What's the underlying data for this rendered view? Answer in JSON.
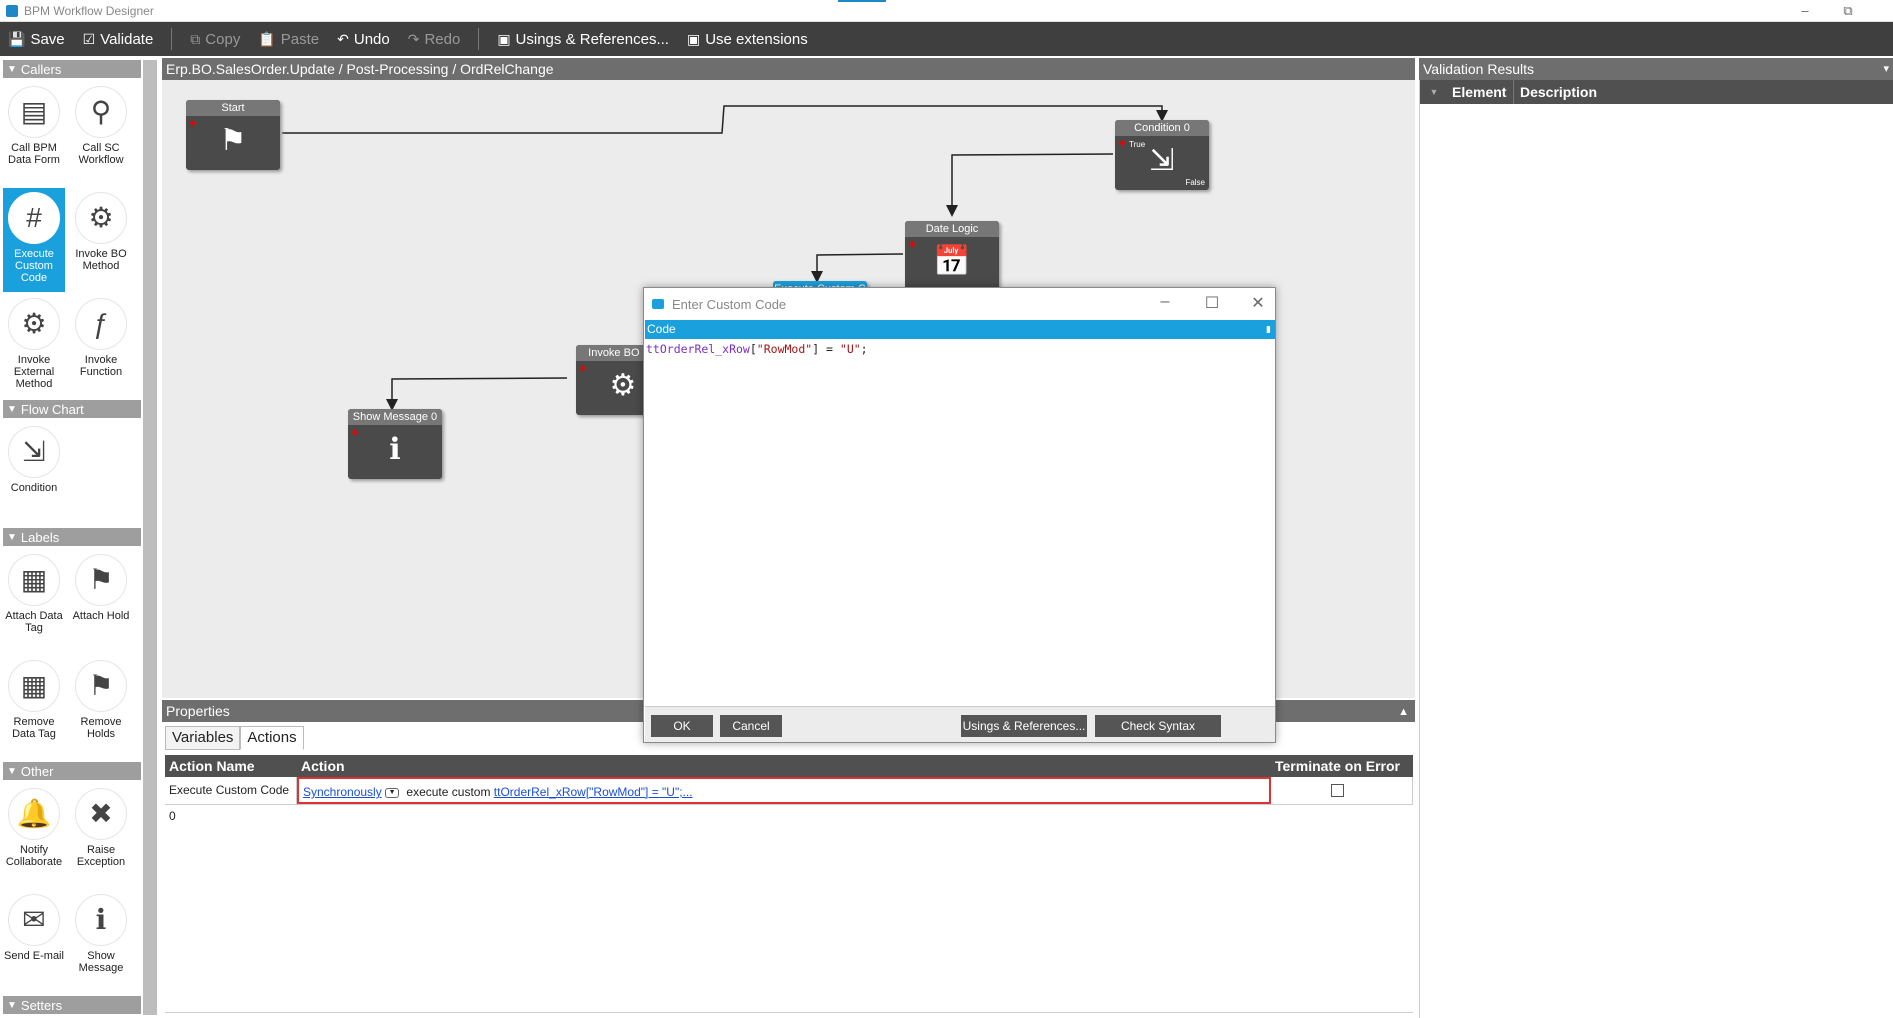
{
  "window": {
    "title": "BPM Workflow Designer"
  },
  "toolbar": {
    "save": "Save",
    "validate": "Validate",
    "copy": "Copy",
    "paste": "Paste",
    "undo": "Undo",
    "redo": "Redo",
    "usings": "Usings & References...",
    "extensions": "Use extensions"
  },
  "palette": {
    "callers": "Callers",
    "call_bpm": "Call BPM Data Form",
    "call_sc": "Call SC Workflow",
    "exec_custom": "Execute Custom Code",
    "invoke_bo": "Invoke BO Method",
    "invoke_ext": "Invoke External Method",
    "invoke_fn": "Invoke Function",
    "flowchart": "Flow Chart",
    "condition": "Condition",
    "labels": "Labels",
    "attach_tag": "Attach Data Tag",
    "attach_hold": "Attach Hold",
    "remove_tag": "Remove Data Tag",
    "remove_holds": "Remove Holds",
    "other": "Other",
    "notify": "Notify Collaborate",
    "raise": "Raise Exception",
    "send_email": "Send E-mail",
    "show_msg": "Show Message",
    "setters": "Setters"
  },
  "canvas": {
    "breadcrumb": "Erp.BO.SalesOrder.Update / Post-Processing / OrdRelChange",
    "nodes": {
      "start": "Start",
      "condition": "Condition 0",
      "cond_true": "True",
      "cond_false": "False",
      "date_logic": "Date Logic",
      "invoke_bo": "Invoke BO Me",
      "show_msg": "Show Message 0",
      "exec_custom": "Execute Custom C"
    }
  },
  "properties": {
    "title": "Properties",
    "tabs": [
      "Variables",
      "Actions"
    ],
    "columns": [
      "Action Name",
      "Action",
      "Terminate on Error"
    ],
    "row": {
      "name": "Execute Custom Code 0",
      "mode": "Synchronously",
      "verb": "execute custom",
      "code_link": "ttOrderRel_xRow[\"RowMod\"] = \"U\";..."
    }
  },
  "validation": {
    "title": "Validation Results",
    "columns": [
      "Element",
      "Description"
    ]
  },
  "dialog": {
    "title": "Enter Custom Code",
    "code_header": "Code",
    "code": {
      "ident": "ttOrderRel_xRow",
      "b1": "[",
      "key": "\"RowMod\"",
      "mid": "] = ",
      "val": "\"U\"",
      "end": ";"
    },
    "ok": "OK",
    "cancel": "Cancel",
    "usings": "Usings & References...",
    "check": "Check Syntax"
  }
}
